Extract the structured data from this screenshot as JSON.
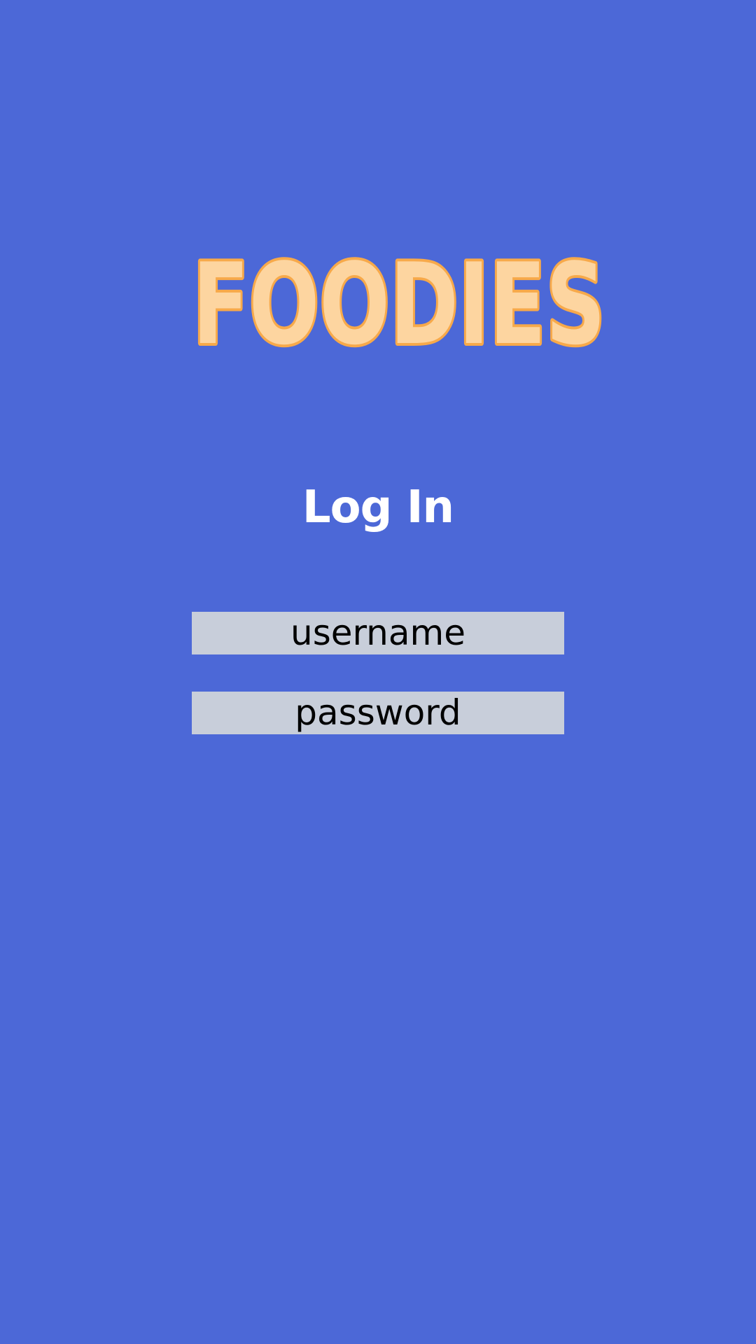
{
  "app": {
    "logo_text": "FOODIES",
    "colors": {
      "background": "#4c68d7",
      "logo_fill": "#fdd5a0",
      "logo_outline": "#f7a94a",
      "field_background": "#c8ceda",
      "title_text": "#ffffff",
      "field_text": "#000000"
    }
  },
  "login": {
    "title": "Log In",
    "username": {
      "placeholder": "username",
      "value": ""
    },
    "password": {
      "placeholder": "password",
      "value": ""
    }
  }
}
